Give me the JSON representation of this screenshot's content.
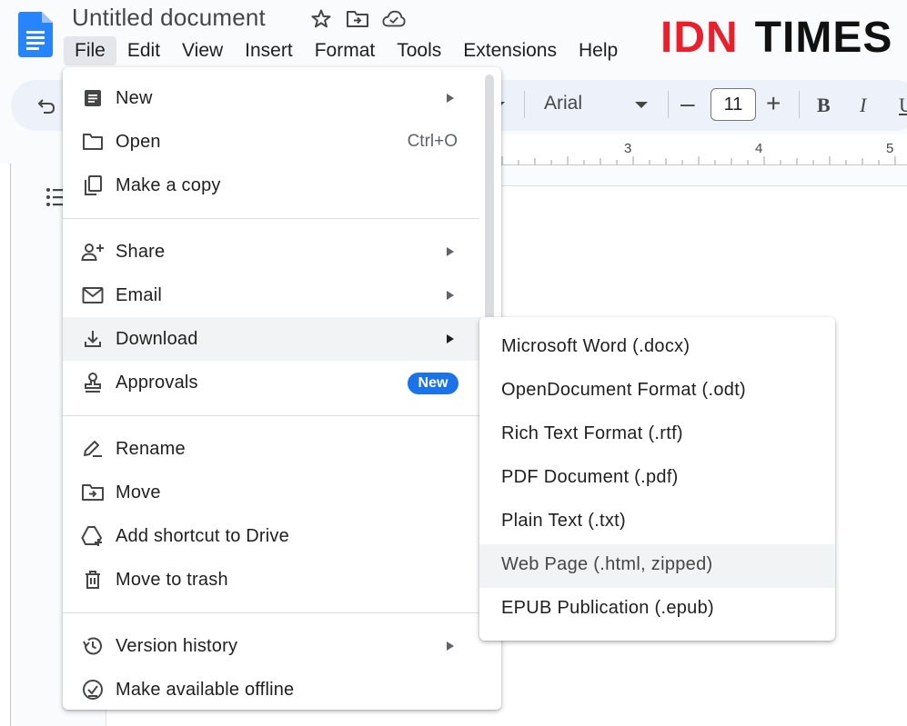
{
  "document": {
    "title": "Untitled document"
  },
  "brand": {
    "part1": "IDN",
    "part2": "TIMES",
    "color_primary": "#e8202c"
  },
  "menubar": {
    "items": [
      "File",
      "Edit",
      "View",
      "Insert",
      "Format",
      "Tools",
      "Extensions",
      "Help"
    ],
    "active": "File"
  },
  "toolbar": {
    "font": "Arial",
    "font_size": "11",
    "minus": "–",
    "plus": "+",
    "bold": "B",
    "italic": "I",
    "underline": "U"
  },
  "ruler": {
    "marks": [
      "3",
      "4",
      "5"
    ]
  },
  "file_menu": {
    "items": [
      {
        "label": "New",
        "icon": "doc-icon",
        "submenu": true
      },
      {
        "label": "Open",
        "icon": "folder-icon",
        "shortcut": "Ctrl+O"
      },
      {
        "label": "Make a copy",
        "icon": "copy-icon"
      },
      {
        "label": "Share",
        "icon": "person-add-icon",
        "submenu": true
      },
      {
        "label": "Email",
        "icon": "mail-icon",
        "submenu": true
      },
      {
        "label": "Download",
        "icon": "download-icon",
        "submenu": true,
        "highlighted": true
      },
      {
        "label": "Approvals",
        "icon": "stamp-icon",
        "badge": "New"
      },
      {
        "label": "Rename",
        "icon": "rename-icon"
      },
      {
        "label": "Move",
        "icon": "move-folder-icon"
      },
      {
        "label": "Add shortcut to Drive",
        "icon": "drive-shortcut-icon"
      },
      {
        "label": "Move to trash",
        "icon": "trash-icon"
      },
      {
        "label": "Version history",
        "icon": "history-icon",
        "submenu": true
      },
      {
        "label": "Make available offline",
        "icon": "offline-icon"
      }
    ]
  },
  "download_menu": {
    "items": [
      {
        "label": "Microsoft Word (.docx)"
      },
      {
        "label": "OpenDocument Format (.odt)"
      },
      {
        "label": "Rich Text Format (.rtf)"
      },
      {
        "label": "PDF Document (.pdf)"
      },
      {
        "label": "Plain Text (.txt)"
      },
      {
        "label": "Web Page (.html, zipped)",
        "highlighted": true
      },
      {
        "label": "EPUB Publication (.epub)"
      }
    ]
  }
}
